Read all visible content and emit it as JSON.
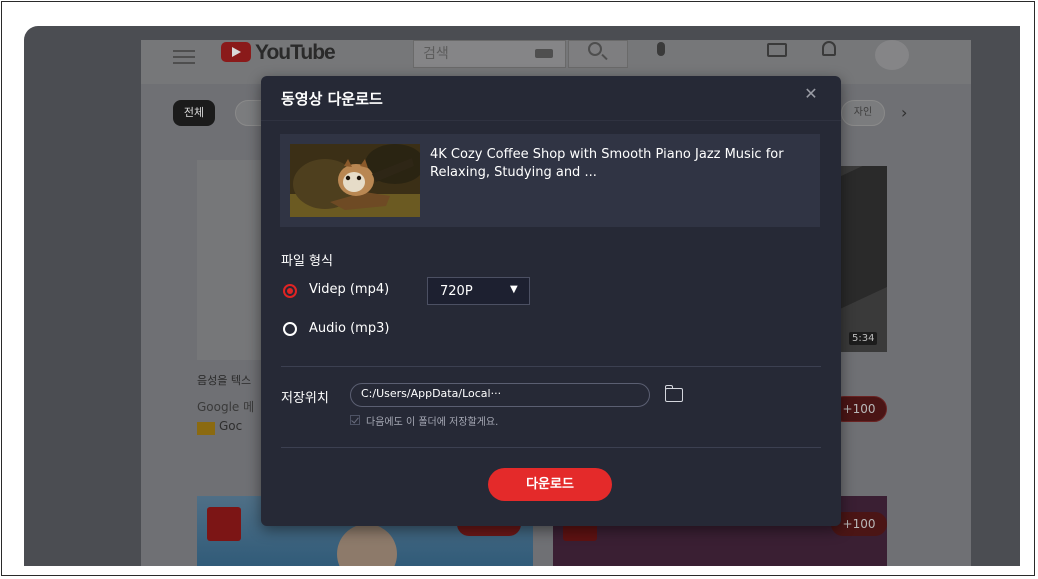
{
  "youtube": {
    "logo_text": "YouTube",
    "search_placeholder": "검색",
    "chips": {
      "all": "전체",
      "right": "자인"
    },
    "video_duration": "5:34",
    "video_title_partial": "음성을 텍스",
    "channel_partial": "Google 메",
    "ad_channel_partial": "Goc",
    "plus_badge": "+100",
    "bottom_plus_badge": "+100"
  },
  "modal": {
    "title": "동영상 다운로드",
    "close_icon": "close-icon",
    "video": {
      "title": "4K Cozy Coffee Shop with Smooth Piano Jazz Music for Relaxing, Studying and ..."
    },
    "format_section_label": "파일 형식",
    "options": [
      {
        "label": "Videp (mp4)",
        "selected": true
      },
      {
        "label": "Audio (mp3)",
        "selected": false
      }
    ],
    "quality": {
      "value": "720P"
    },
    "save_location_label": "저장위치",
    "save_path": "C:/Users/AppData/Local···",
    "remember_folder_label": "다음에도 이 폴더에 저장할게요.",
    "remember_folder_checked": true,
    "download_button": "다운로드"
  },
  "colors": {
    "modal_bg": "#262936",
    "accent_red": "#e42a2a",
    "card_bg": "#303444"
  }
}
